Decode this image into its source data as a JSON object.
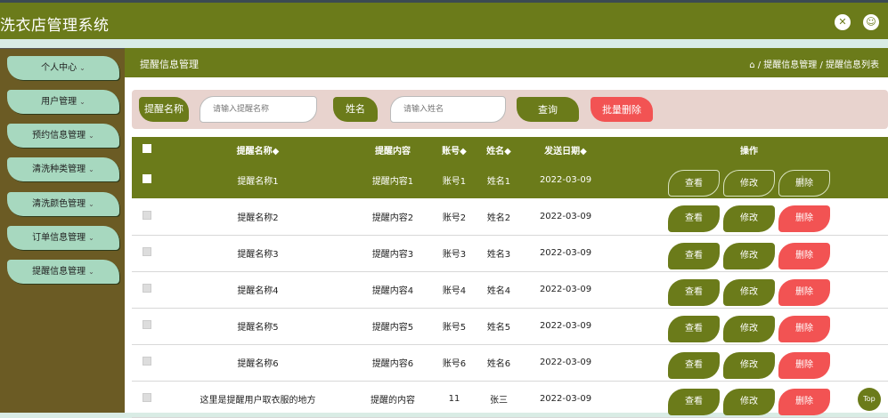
{
  "app": {
    "title": "洗衣店管理系统"
  },
  "header_icons": [
    "fullscreen-icon",
    "user-icon"
  ],
  "sidebar": {
    "items": [
      {
        "label": "个人中心"
      },
      {
        "label": "用户管理"
      },
      {
        "label": "预约信息管理"
      },
      {
        "label": "清洗种类管理"
      },
      {
        "label": "清洗颜色管理"
      },
      {
        "label": "订单信息管理"
      },
      {
        "label": "提醒信息管理"
      }
    ]
  },
  "page": {
    "title": "提醒信息管理",
    "breadcrumb": "⌂ / 提醒信息管理 / 提醒信息列表"
  },
  "search": {
    "name_label": "提醒名称",
    "name_placeholder": "请输入提醒名称",
    "person_label": "姓名",
    "person_placeholder": "请输入姓名",
    "query_button": "查询",
    "batch_delete_button": "批量删除"
  },
  "table": {
    "headers": [
      "提醒名称◆",
      "提醒内容",
      "账号◆",
      "姓名◆",
      "发送日期◆",
      "操作"
    ],
    "actions": {
      "view": "查看",
      "edit": "修改",
      "delete": "删除"
    },
    "rows": [
      {
        "name": "提醒名称1",
        "content": "提醒内容1",
        "account": "账号1",
        "person": "姓名1",
        "date": "2022-03-09"
      },
      {
        "name": "提醒名称2",
        "content": "提醒内容2",
        "account": "账号2",
        "person": "姓名2",
        "date": "2022-03-09"
      },
      {
        "name": "提醒名称3",
        "content": "提醒内容3",
        "account": "账号3",
        "person": "姓名3",
        "date": "2022-03-09"
      },
      {
        "name": "提醒名称4",
        "content": "提醒内容4",
        "account": "账号4",
        "person": "姓名4",
        "date": "2022-03-09"
      },
      {
        "name": "提醒名称5",
        "content": "提醒内容5",
        "account": "账号5",
        "person": "姓名5",
        "date": "2022-03-09"
      },
      {
        "name": "提醒名称6",
        "content": "提醒内容6",
        "account": "账号6",
        "person": "姓名6",
        "date": "2022-03-09"
      },
      {
        "name": "这里是提醒用户取衣服的地方",
        "content": "提醒的内容",
        "account": "11",
        "person": "张三",
        "date": "2022-03-09"
      }
    ]
  },
  "top_button": "Top",
  "colors": {
    "primary": "#6b7b1a",
    "sidebar": "#6b5b24",
    "menu": "#a7d8bf",
    "danger": "#f25353"
  }
}
